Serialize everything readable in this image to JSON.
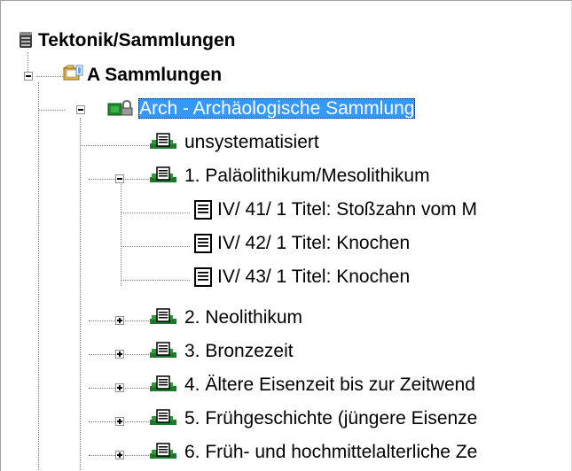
{
  "tree": {
    "root": {
      "label": "Tektonik/Sammlungen",
      "icon": "database-icon"
    },
    "group": {
      "label": "A Sammlungen",
      "icon": "folder-icon"
    },
    "selected": {
      "label": "Arch - Archäologische Sammlung",
      "icon": "locked-collection-icon"
    },
    "items": [
      {
        "label": "unsystematisiert",
        "icon": "series-icon"
      },
      {
        "label": "1. Paläolithikum/Mesolithikum",
        "icon": "series-icon",
        "expanded": true
      },
      {
        "label": "IV/ 41/ 1 Titel: Stoßzahn vom M",
        "icon": "record-icon"
      },
      {
        "label": "IV/ 42/ 1 Titel: Knochen",
        "icon": "record-icon"
      },
      {
        "label": "IV/ 43/ 1 Titel: Knochen",
        "icon": "record-icon"
      },
      {
        "label": "2. Neolithikum",
        "icon": "series-icon",
        "expanded": false
      },
      {
        "label": "3. Bronzezeit",
        "icon": "series-icon",
        "expanded": false
      },
      {
        "label": "4. Ältere Eisenzeit bis zur Zeitwend",
        "icon": "series-icon",
        "expanded": false
      },
      {
        "label": "5. Frühgeschichte (jüngere Eisenze",
        "icon": "series-icon",
        "expanded": false
      },
      {
        "label": "6. Früh- und hochmittelalterliche Ze",
        "icon": "series-icon",
        "expanded": false
      }
    ]
  },
  "colors": {
    "selection": "#3399ff",
    "tree_lines": "#808080"
  }
}
